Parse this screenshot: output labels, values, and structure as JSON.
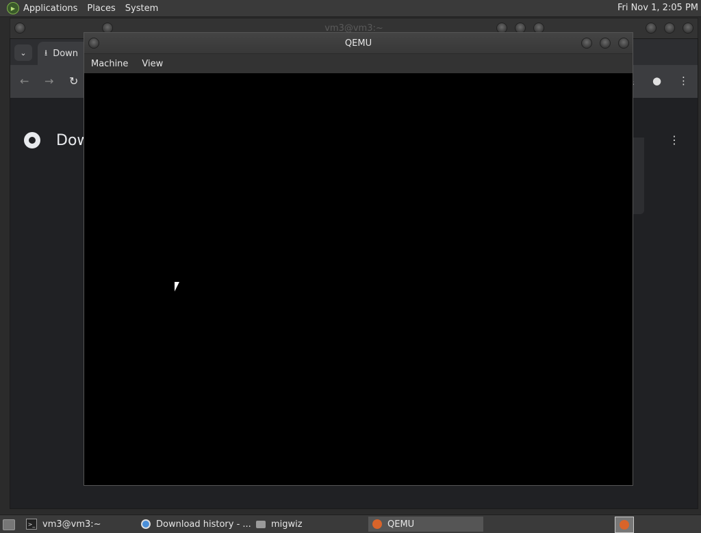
{
  "top_panel": {
    "menus": [
      "Applications",
      "Places",
      "System"
    ],
    "clock": "Fri Nov 1, 2:05 PM"
  },
  "terminal_window": {
    "title": "vm3@vm3:~"
  },
  "chrome": {
    "tab_label": "Down",
    "page_heading": "Dow"
  },
  "qemu": {
    "title": "QEMU",
    "menus": [
      "Machine",
      "View"
    ]
  },
  "taskbar": {
    "tasks": [
      {
        "label": "vm3@vm3:~",
        "icon": "terminal-icon"
      },
      {
        "label": "Download history - ...",
        "icon": "chrome-icon"
      },
      {
        "label": "migwiz",
        "icon": "folder-icon"
      },
      {
        "label": "QEMU",
        "icon": "qemu-icon"
      }
    ]
  }
}
